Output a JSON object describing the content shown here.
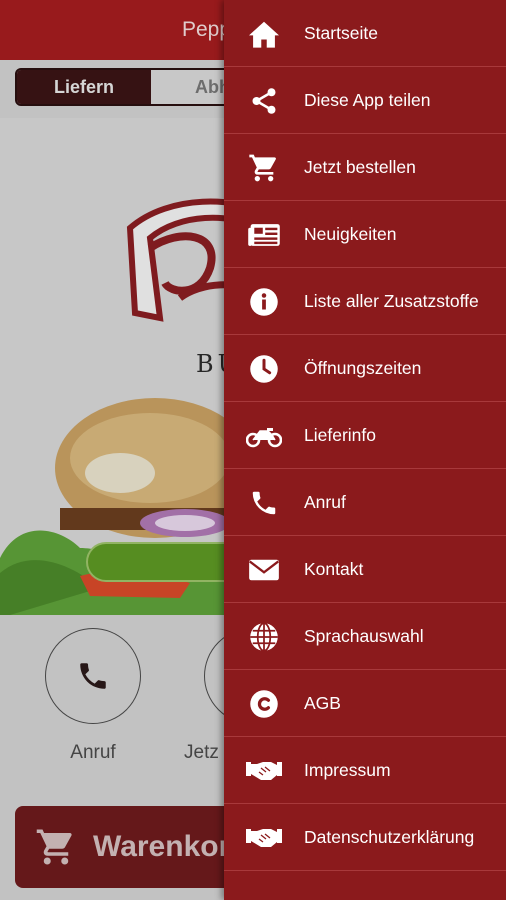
{
  "app": {
    "title": "Pepp",
    "delivery_toggle": {
      "deliver": "Liefern",
      "pickup": "Abho"
    },
    "logo_sub": "BU",
    "quick_actions": [
      {
        "label": "Anruf",
        "icon": "phone-icon"
      },
      {
        "label": "Jetz",
        "icon": "cart-icon"
      }
    ],
    "cart_button": {
      "label": "Warenkorb",
      "icon": "cart-icon"
    }
  },
  "drawer": {
    "background": "#8b1a1c",
    "items": [
      {
        "label": "Startseite",
        "icon": "home-icon"
      },
      {
        "label": "Diese App teilen",
        "icon": "share-icon"
      },
      {
        "label": "Jetzt bestellen",
        "icon": "cart-icon"
      },
      {
        "label": "Neuigkeiten",
        "icon": "news-icon"
      },
      {
        "label": "Liste aller Zusatzstoffe",
        "icon": "info-icon"
      },
      {
        "label": "Öffnungszeiten",
        "icon": "clock-icon"
      },
      {
        "label": "Lieferinfo",
        "icon": "motorcycle-icon"
      },
      {
        "label": "Anruf",
        "icon": "phone-icon"
      },
      {
        "label": "Kontakt",
        "icon": "envelope-icon"
      },
      {
        "label": "Sprachauswahl",
        "icon": "globe-icon"
      },
      {
        "label": "AGB",
        "icon": "copyright-icon"
      },
      {
        "label": "Impressum",
        "icon": "handshake-icon"
      },
      {
        "label": "Datenschutzerklärung",
        "icon": "handshake-icon"
      }
    ]
  },
  "colors": {
    "header": "#a51d1f",
    "drawer": "#8b1a1c",
    "accent_green": "#5e9a24"
  }
}
